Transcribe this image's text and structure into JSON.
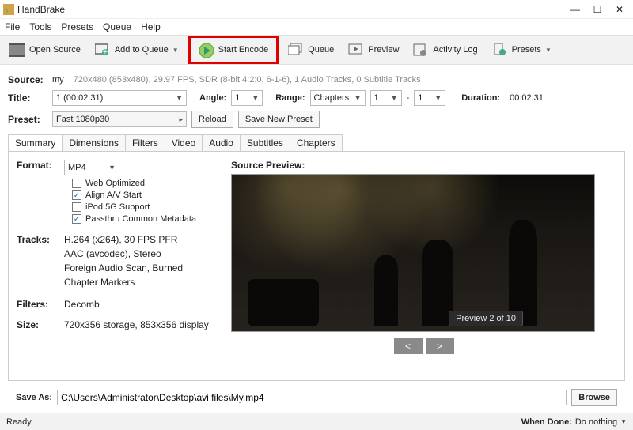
{
  "window": {
    "title": "HandBrake"
  },
  "menu": {
    "file": "File",
    "tools": "Tools",
    "presets": "Presets",
    "queue": "Queue",
    "help": "Help"
  },
  "toolbar": {
    "open_source": "Open Source",
    "add_queue": "Add to Queue",
    "start_encode": "Start Encode",
    "queue": "Queue",
    "preview": "Preview",
    "activity_log": "Activity Log",
    "presets": "Presets"
  },
  "source": {
    "label": "Source:",
    "name": "my",
    "info": "720x480 (853x480), 29.97 FPS, SDR (8-bit 4:2:0, 6-1-6), 1 Audio Tracks, 0 Subtitle Tracks"
  },
  "title_row": {
    "title_label": "Title:",
    "title_value": "1 (00:02:31)",
    "angle_label": "Angle:",
    "angle_value": "1",
    "range_label": "Range:",
    "range_type": "Chapters",
    "range_from": "1",
    "range_to": "1",
    "dash": "-",
    "duration_label": "Duration:",
    "duration_value": "00:02:31"
  },
  "preset_row": {
    "label": "Preset:",
    "value": "Fast 1080p30",
    "reload": "Reload",
    "save_new": "Save New Preset"
  },
  "tabs": {
    "summary": "Summary",
    "dimensions": "Dimensions",
    "filters": "Filters",
    "video": "Video",
    "audio": "Audio",
    "subtitles": "Subtitles",
    "chapters": "Chapters"
  },
  "summary": {
    "format_label": "Format:",
    "format_value": "MP4",
    "web_optimized": "Web Optimized",
    "align_av": "Align A/V Start",
    "ipod": "iPod 5G Support",
    "passthru": "Passthru Common Metadata",
    "tracks_label": "Tracks:",
    "tracks": [
      "H.264 (x264), 30 FPS PFR",
      "AAC (avcodec), Stereo",
      "Foreign Audio Scan, Burned",
      "Chapter Markers"
    ],
    "filters_label": "Filters:",
    "filters_value": "Decomb",
    "size_label": "Size:",
    "size_value": "720x356 storage, 853x356 display"
  },
  "preview": {
    "title": "Source Preview:",
    "badge": "Preview 2 of 10",
    "prev": "<",
    "next": ">"
  },
  "saveas": {
    "label": "Save As:",
    "path": "C:\\Users\\Administrator\\Desktop\\avi files\\My.mp4",
    "browse": "Browse"
  },
  "status": {
    "ready": "Ready",
    "when_done_label": "When Done:",
    "when_done_value": "Do nothing"
  }
}
